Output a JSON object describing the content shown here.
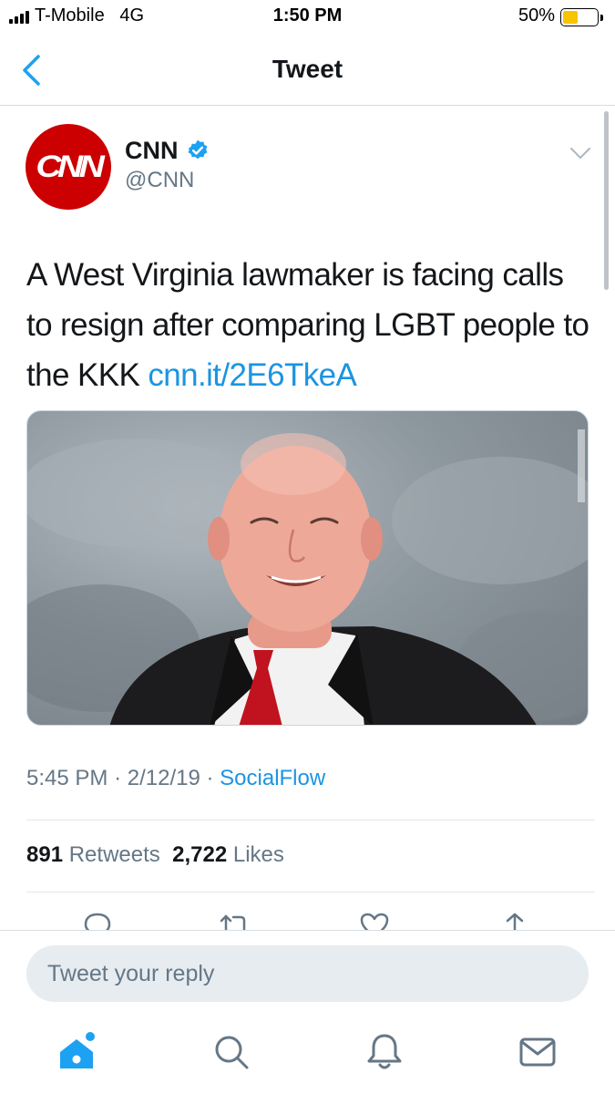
{
  "status_bar": {
    "carrier": "T-Mobile   4G",
    "time": "1:50 PM",
    "battery_percent": "50%",
    "battery_level": 0.5,
    "battery_color": "#f6c500"
  },
  "nav": {
    "title": "Tweet",
    "back_icon": "chevron-left-icon"
  },
  "tweet": {
    "author": {
      "display_name": "CNN",
      "handle": "@CNN",
      "avatar_text": "CNN",
      "avatar_color": "#cc0000",
      "verified": true
    },
    "text": "A West Virginia lawmaker is facing calls to resign after comparing LGBT people to the KKK",
    "link": "cnn.it/2E6TkeA",
    "media": "photo of a smiling bald man in a dark suit and red tie against a grey backdrop",
    "time": "5:45 PM",
    "date": "2/12/19",
    "separator": "·",
    "source": "SocialFlow",
    "retweets_count": "891",
    "retweets_label": "Retweets",
    "likes_count": "2,722",
    "likes_label": "Likes"
  },
  "actions": [
    "reply-icon",
    "retweet-icon",
    "like-icon",
    "share-icon"
  ],
  "reply": {
    "placeholder": "Tweet your reply"
  },
  "tab_bar": {
    "tabs": [
      "home-icon",
      "search-icon",
      "notifications-icon",
      "messages-icon"
    ],
    "active": "home-icon"
  },
  "colors": {
    "accent": "#1da1f2",
    "link": "#1b95e0",
    "text": "#14171a",
    "secondary": "#657786"
  }
}
